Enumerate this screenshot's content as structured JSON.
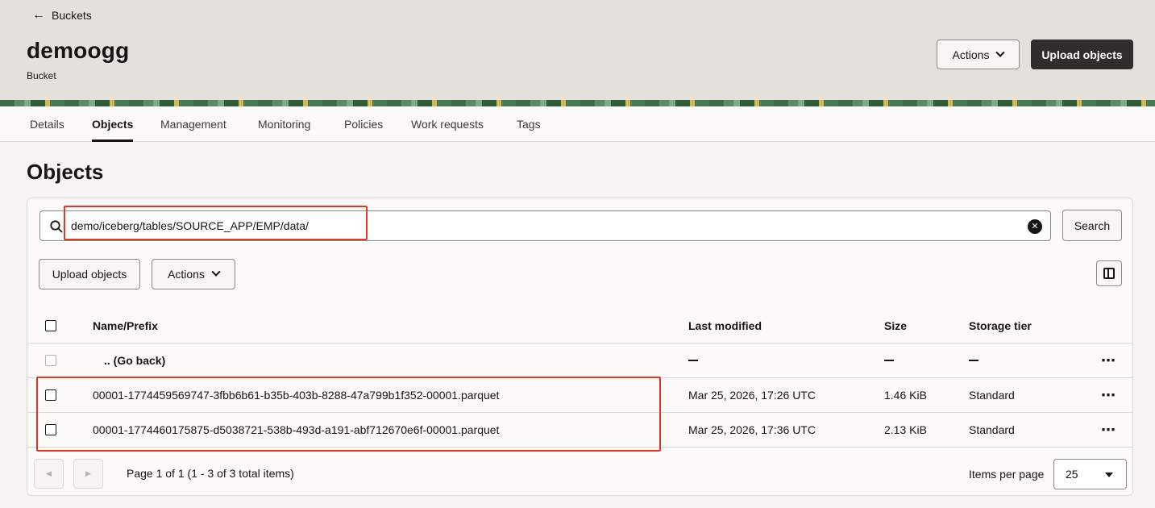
{
  "header": {
    "back_label": "Buckets",
    "bucket_name": "demoogg",
    "bucket_type": "Bucket",
    "actions_label": "Actions",
    "upload_label": "Upload objects"
  },
  "tabs": [
    {
      "label": "Details"
    },
    {
      "label": "Objects",
      "active": true
    },
    {
      "label": "Management"
    },
    {
      "label": "Monitoring"
    },
    {
      "label": "Policies"
    },
    {
      "label": "Work requests"
    },
    {
      "label": "Tags"
    }
  ],
  "section_title": "Objects",
  "search": {
    "value": "demo/iceberg/tables/SOURCE_APP/EMP/data/",
    "button_label": "Search"
  },
  "toolbar": {
    "upload_label": "Upload objects",
    "actions_label": "Actions"
  },
  "table": {
    "columns": [
      "Name/Prefix",
      "Last modified",
      "Size",
      "Storage tier"
    ],
    "go_back_label": ".. (Go back)",
    "rows": [
      {
        "name": "00001-1774459569747-3fbb6b61-b35b-403b-8288-47a799b1f352-00001.parquet",
        "modified": "Mar 25, 2026, 17:26 UTC",
        "size": "1.46 KiB",
        "tier": "Standard"
      },
      {
        "name": "00001-1774460175875-d5038721-538b-493d-a191-abf712670e6f-00001.parquet",
        "modified": "Mar 25, 2026, 17:36 UTC",
        "size": "2.13 KiB",
        "tier": "Standard"
      }
    ]
  },
  "pagination": {
    "text": "Page 1 of 1 (1 - 3 of 3 total items)",
    "items_per_page_label": "Items per page",
    "items_per_page": "25"
  },
  "colors": {
    "primary_button": "#312d2a",
    "highlight": "#e0372b"
  }
}
